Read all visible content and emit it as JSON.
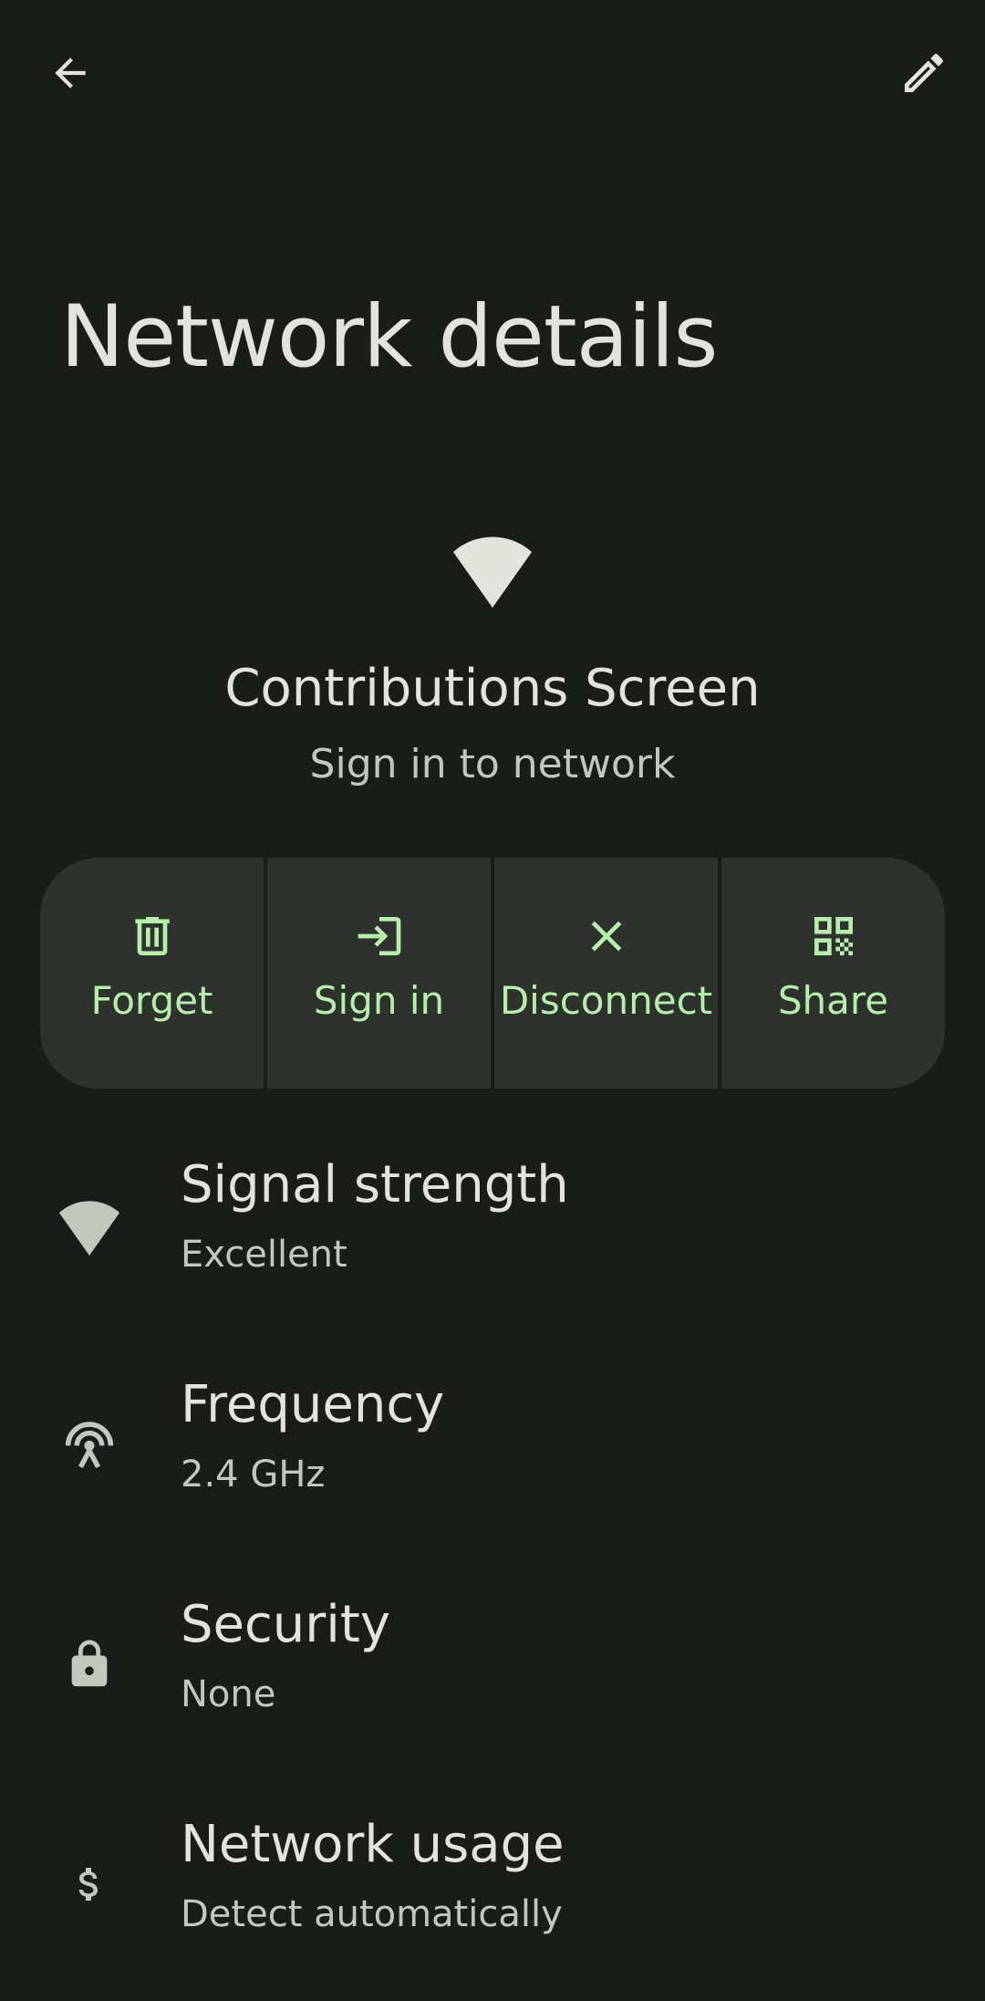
{
  "header": {
    "back_icon": "arrow-back-icon",
    "edit_icon": "pencil-icon",
    "title": "Network details"
  },
  "network": {
    "icon": "wifi-icon",
    "name": "Contributions Screen",
    "status": "Sign in to network"
  },
  "actions": [
    {
      "label": "Forget",
      "icon": "trash-icon"
    },
    {
      "label": "Sign in",
      "icon": "login-icon"
    },
    {
      "label": "Disconnect",
      "icon": "close-icon"
    },
    {
      "label": "Share",
      "icon": "qr-code-icon"
    }
  ],
  "details": [
    {
      "title": "Signal strength",
      "value": "Excellent",
      "icon": "wifi-icon"
    },
    {
      "title": "Frequency",
      "value": "2.4 GHz",
      "icon": "antenna-icon"
    },
    {
      "title": "Security",
      "value": "None",
      "icon": "lock-icon"
    },
    {
      "title": "Network usage",
      "value": "Detect automatically",
      "icon": "dollar-icon"
    }
  ],
  "colors": {
    "background": "#1a1c19",
    "accent": "#b6efab",
    "button_surface": "#2d322c",
    "text_primary": "#e2e3dd",
    "text_secondary": "#c3c8bf"
  }
}
